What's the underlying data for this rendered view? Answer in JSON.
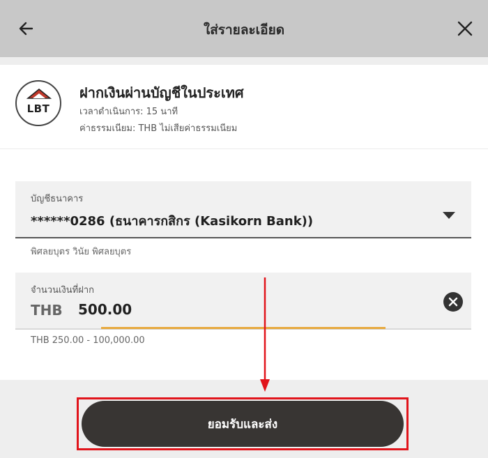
{
  "header": {
    "title": "ใส่รายละเอียด"
  },
  "method": {
    "logo_text": "LBT",
    "title": "ฝากเงินผ่านบัญชีในประเทศ",
    "processing_time": "เวลาดำเนินการ: 15 นาที",
    "fee": "ค่าธรรมเนียม: THB ไม่เสียค่าธรรมเนียม"
  },
  "bank_account": {
    "label": "บัญชีธนาคาร",
    "value": "******0286 (ธนาคารกสิกร (Kasikorn Bank))",
    "account_name": "พิศลยบุตร วินัย พิศลยบุตร"
  },
  "amount": {
    "label": "จำนวนเงินที่ฝาก",
    "currency": "THB",
    "value": "500.00",
    "range": "THB 250.00 - 100,000.00"
  },
  "submit": {
    "label": "ยอมรับและส่ง"
  },
  "colors": {
    "header_bg": "#c8c8c8",
    "button_bg": "#383533",
    "focus_accent": "#e7a93e",
    "annotation_red": "#e1141b"
  }
}
